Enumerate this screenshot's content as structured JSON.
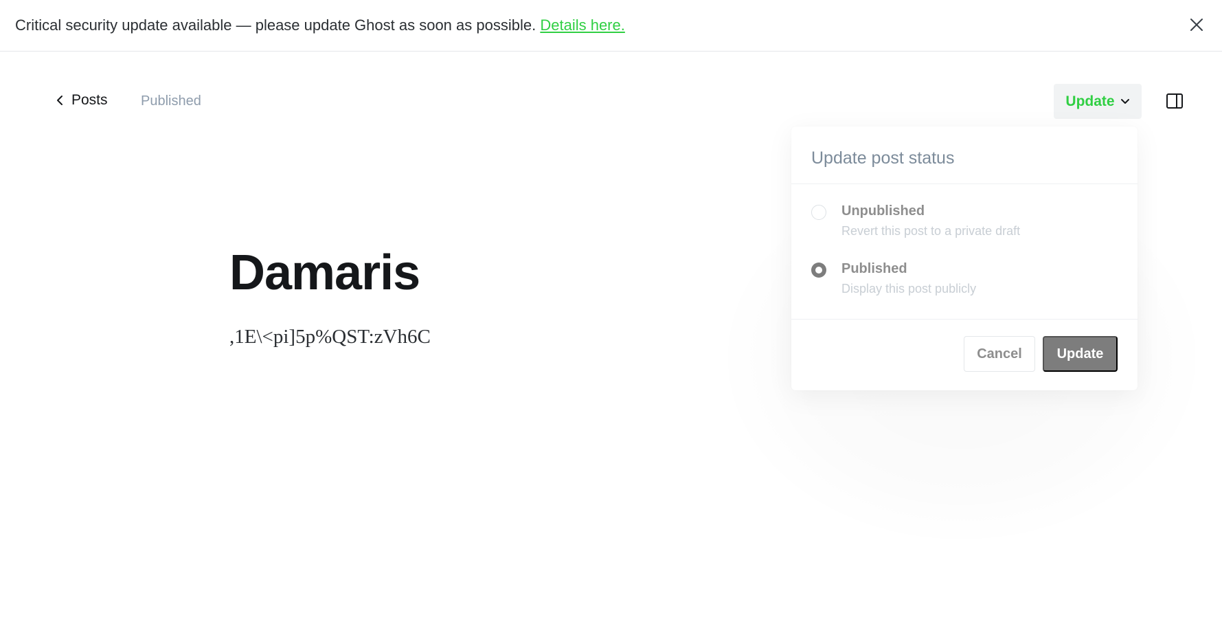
{
  "banner": {
    "message": "Critical security update available — please update Ghost as soon as possible.",
    "link_label": "Details here."
  },
  "nav": {
    "back_label": "Posts",
    "status": "Published"
  },
  "toolbar": {
    "update_label": "Update"
  },
  "editor": {
    "title": "Damaris",
    "body": ",1E\\<pi]5p%QST:zVh6C"
  },
  "popup": {
    "title": "Update post status",
    "options": [
      {
        "label": "Unpublished",
        "description": "Revert this post to a private draft",
        "checked": false
      },
      {
        "label": "Published",
        "description": "Display this post publicly",
        "checked": true
      }
    ],
    "cancel_label": "Cancel",
    "update_label": "Update"
  },
  "colors": {
    "accent": "#30cf43",
    "muted_button": "#7d7d7d"
  }
}
